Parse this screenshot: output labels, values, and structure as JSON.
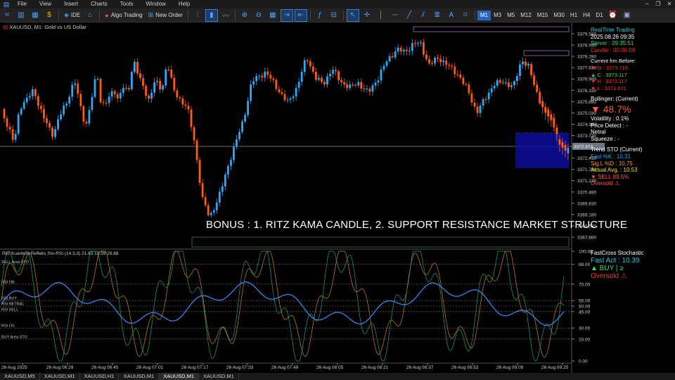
{
  "menu": {
    "items": [
      "File",
      "View",
      "Insert",
      "Charts",
      "Tools",
      "Window",
      "Help"
    ]
  },
  "toolbar": {
    "ide_label": "IDE",
    "algo_label": "Algo Trading",
    "new_order_label": "New Order",
    "timeframes": [
      "M1",
      "M3",
      "M5",
      "M12",
      "M15",
      "M30",
      "H1",
      "H4",
      "D1"
    ],
    "active_timeframe": "M1"
  },
  "chart": {
    "header": "XAUUSD, M1:  Gold vs US Dollar",
    "bonus_text": "BONUS : 1. RITZ KAMA CANDLE,  2. SUPPORT RESISTANCE MARKET STRUCTURE",
    "price_labels": [
      "3379.580",
      "3378.930",
      "3378.280",
      "3377.630",
      "3376.980",
      "3376.330",
      "3375.680",
      "3375.030",
      "3374.380",
      "3373.730",
      "3373.080",
      "3372.430",
      "3371.780",
      "3371.130",
      "3370.480",
      "3369.830",
      "3369.180",
      "3368.530",
      "3367.880"
    ],
    "current_price": "3372.872",
    "time_labels": [
      "26 Aug 2025",
      "26 Aug 06:29",
      "26 Aug 06:45",
      "26 Aug 07:01",
      "26 Aug 07:17",
      "26 Aug 07:33",
      "26 Aug 07:49",
      "26 Aug 08:05",
      "26 Aug 08:21",
      "26 Aug 08:37",
      "26 Aug 08:53",
      "26 Aug 09:09",
      "26 Aug 09:25"
    ],
    "colors": {
      "bull": "#2ea8f5",
      "bear": "#ff5a14",
      "box": "#0c0c99"
    }
  },
  "info": {
    "realtime_title": "RealTime Trading",
    "datetime": "2025.08.26 09:35",
    "server": "Server : 09:35:51",
    "candle": "Candle : 00:00:09",
    "current_before_title": "Current frm Before:",
    "o": "▼ O : 3373.716",
    "c": "▲ C : 3373.117",
    "h": "▼ H : 3373.117",
    "l": "▼ L : 3371.671",
    "bollinger_title": "Bollinger: (Current)",
    "bollinger_value": "▼ 48.7%",
    "volatility": "Volatility : 0.1%",
    "price_detect": "Price Detect : -",
    "netral": "Netral",
    "squeeze": "Squeeze : -",
    "trend_title": "Trend STO (Current)",
    "fast_k": "Fast %K : 10.31",
    "sig_d": "Sig.L %D : 10.75",
    "actual_avg": "Actual Avg. : 10.53",
    "sell": "▼ SELL  89.5%",
    "oversold": "Oversold ⚠"
  },
  "sub": {
    "header": "Ritz Kuantum Refleks Sto-RSI (14,3,3) 21.63 12.59 29.68",
    "level_labels": [
      "SELL Area STO",
      "RSI OB",
      "RSI BUY",
      "RSI NETRAL",
      "RSI SELL",
      "RSI OS",
      "BUY Area STO"
    ],
    "axis_labels": [
      "100.00",
      "88.00",
      "70.00",
      "55.00",
      "50.00",
      "45.00",
      "30.00",
      "20.00",
      "0.00"
    ],
    "fastcross_title": "FastCross Stochastic",
    "fast_act": "Fast Act : 10.39",
    "buy": "▲ BUY | ≥",
    "oversold": "Oversold ⚠"
  },
  "tabs": [
    "XAUUSD,M5",
    "XAUUSD,M1",
    "XAUUSD,H1",
    "XAUUSD,M1",
    "XAUUSD,M1",
    "XAUUSD,M1"
  ],
  "active_tab": 4
}
